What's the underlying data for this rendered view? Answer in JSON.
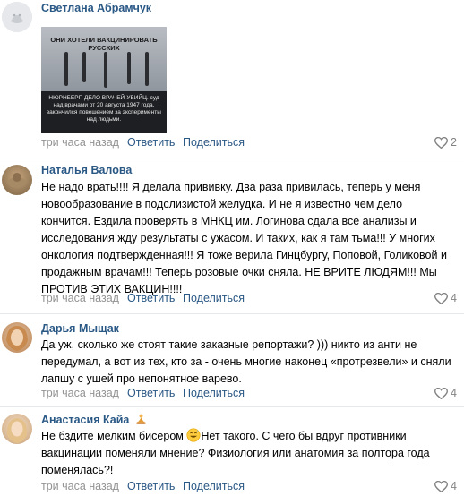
{
  "comments": [
    {
      "author": "Светлана Абрамчук",
      "attachment": {
        "title": "ОНИ ХОТЕЛИ ВАКЦИНИРОВАТЬ РУССКИХ",
        "caption": "НЮРНБЕРГ. ДЕЛО ВРАЧЕЙ-УБИЙЦ. суд над врачами от 20 августа 1947 года, закончился повешением за эксперименты над людьми."
      },
      "time": "три часа назад",
      "reply": "Ответить",
      "share": "Поделиться",
      "likes": "2"
    },
    {
      "author": "Наталья Валова",
      "text": "Не надо врать!!!! Я делала прививку. Два раза привилась, теперь у меня новообразование в подслизистой желудка. И не я известно чем дело кончится. Ездила проверять в МНКЦ им. Логинова сдала все анализы и исследования жду результаты с ужасом. И таких, как я там тьма!!! У многих онкология подтвержденная!!! Я тоже верила Гинцбургу, Поповой, Голиковой и продажным врачам!!! Теперь розовые очки сняла. НЕ ВРИТЕ ЛЮДЯМ!!! Мы ПРОТИВ ЭТИХ ВАКЦИН!!!!",
      "time": "три часа назад",
      "reply": "Ответить",
      "share": "Поделиться",
      "likes": "4"
    },
    {
      "author": "Дарья Мыщак",
      "text": "Да уж, сколько же стоят такие заказные репортажи? ))) никто из анти не передумал, а вот из тех, кто за - очень многие наконец «протрезвели» и сняли лапшу с ушей про непонятное варево.",
      "time": "три часа назад",
      "reply": "Ответить",
      "share": "Поделиться",
      "likes": "4"
    },
    {
      "author": "Анастасия Кайа",
      "text_before_emoji": "Не бздите мелким бисером ",
      "text_after_emoji": "Нет такого. С чего бы вдруг противники вакцинации поменяли мнение? Физиология или анатомия за полтора года поменялась?!",
      "time": "три часа назад",
      "reply": "Ответить",
      "share": "Поделиться",
      "likes": "4"
    }
  ],
  "colors": {
    "link": "#2a5885",
    "meta": "#939393",
    "separator": "#e7e8ec"
  },
  "icons": [
    "heart-icon",
    "smiling-emoji-icon",
    "meditating-emoji-icon"
  ]
}
